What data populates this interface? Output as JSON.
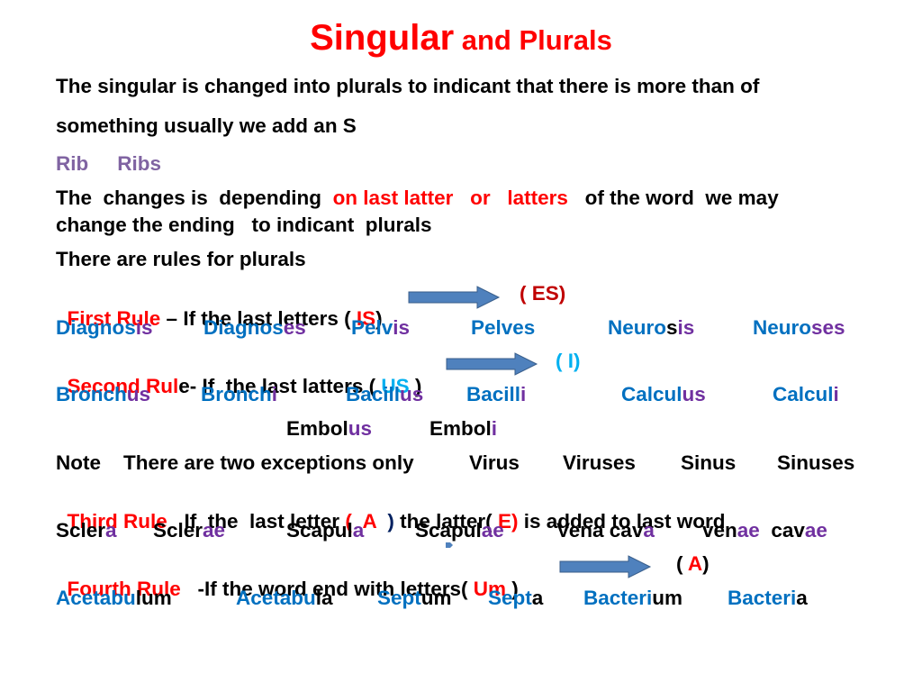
{
  "title": {
    "main": "Singular",
    "rest": " and Plurals"
  },
  "intro": {
    "line1": "The  singular is changed  into plurals to indicant that  there is more than of",
    "line2": "something  usually we add  an S"
  },
  "example_s": {
    "singular": "Rib",
    "plural": "Ribs"
  },
  "changes": {
    "part1": "The  changes is  depending  ",
    "red1": "on last latter",
    "gap1": "   ",
    "red2": "or",
    "gap2": "   ",
    "red3": "latters",
    "part2": "   of the word  we may",
    "line2": "change the ending   to indicant  plurals"
  },
  "rules_intro": "There are rules for plurals",
  "rule1": {
    "label": "First Rule",
    "text": " – If the last letters ( ",
    "from": "IS",
    "close": ")",
    "to_open": "( ",
    "to": "ES",
    "to_close": ")",
    "examples": [
      {
        "stem": "Diagno",
        "mid": "s",
        "end": "is"
      },
      {
        "stem": "Diagno",
        "mid": "s",
        "end": "es"
      },
      {
        "stem": "Pelv",
        "mid": "",
        "end": "is"
      },
      {
        "stem": "Pelves",
        "mid": "",
        "end": ""
      },
      {
        "stem": "Neuro",
        "mid": "s",
        "end": "is"
      },
      {
        "stem": "Neuro",
        "mid": "",
        "end": "ses"
      }
    ]
  },
  "rule2": {
    "label_red": "Second Rul",
    "label_black": "e- If  the last latters ( ",
    "from": "US",
    "close": " )",
    "to": "( I)",
    "examples": [
      {
        "stem": "Bronch",
        "end": "us"
      },
      {
        "stem": "Bronch",
        "end": "i"
      },
      {
        "stem": "Bacill",
        "end": "us"
      },
      {
        "stem": "Bacill",
        "end": "i"
      },
      {
        "stem": "Calcul",
        "end": "us"
      },
      {
        "stem": "Calcul",
        "end": "i"
      }
    ],
    "extra": [
      {
        "stem": "Embol",
        "end": "us"
      },
      {
        "stem": "Embol",
        "end": "i"
      }
    ]
  },
  "note": {
    "text": "Note    There are two exceptions only",
    "words": [
      "Virus",
      "Viruses",
      "Sinus",
      "Sinuses"
    ]
  },
  "rule3": {
    "label": "Third Rule",
    "text1": "   If  the  last letter ",
    "open": "(",
    "letter": "  A  ",
    "close": ")",
    "text2": " the latter( ",
    "added": "E)",
    "text3": " is added to last word",
    "examples": [
      {
        "stem": "Scler",
        "end": "a"
      },
      {
        "stem": "Scler",
        "end": "ae"
      },
      {
        "stem": "Scapul",
        "end": "a"
      },
      {
        "stem": "Scapul",
        "end": "ae"
      },
      {
        "stem": "Vena cav",
        "end": "a"
      },
      {
        "stem": "ven",
        "end": "ae",
        "stem2": "  cav",
        "end2": "ae"
      }
    ]
  },
  "rule4": {
    "label": "Fourth Rule",
    "text": "   -If the word end with letters( ",
    "from": "Um",
    "close": " )",
    "to_open": "( ",
    "to": "A",
    "to_close": ")",
    "examples": [
      {
        "stem": "Acetabu",
        "end": "lum"
      },
      {
        "stem": "Acetabu",
        "end": "la"
      },
      {
        "stem": "Sept",
        "end": "um"
      },
      {
        "stem": "Sept",
        "end": "a"
      },
      {
        "stem": "Bacteri",
        "end": "um"
      },
      {
        "stem": "Bacteri",
        "end": "a"
      }
    ]
  },
  "colors": {
    "title": "#ff0000",
    "accent_red": "#ff0000",
    "example_blue": "#0070c0",
    "suffix_purple": "#7030a0",
    "arrow_fill": "#4f81bd"
  }
}
